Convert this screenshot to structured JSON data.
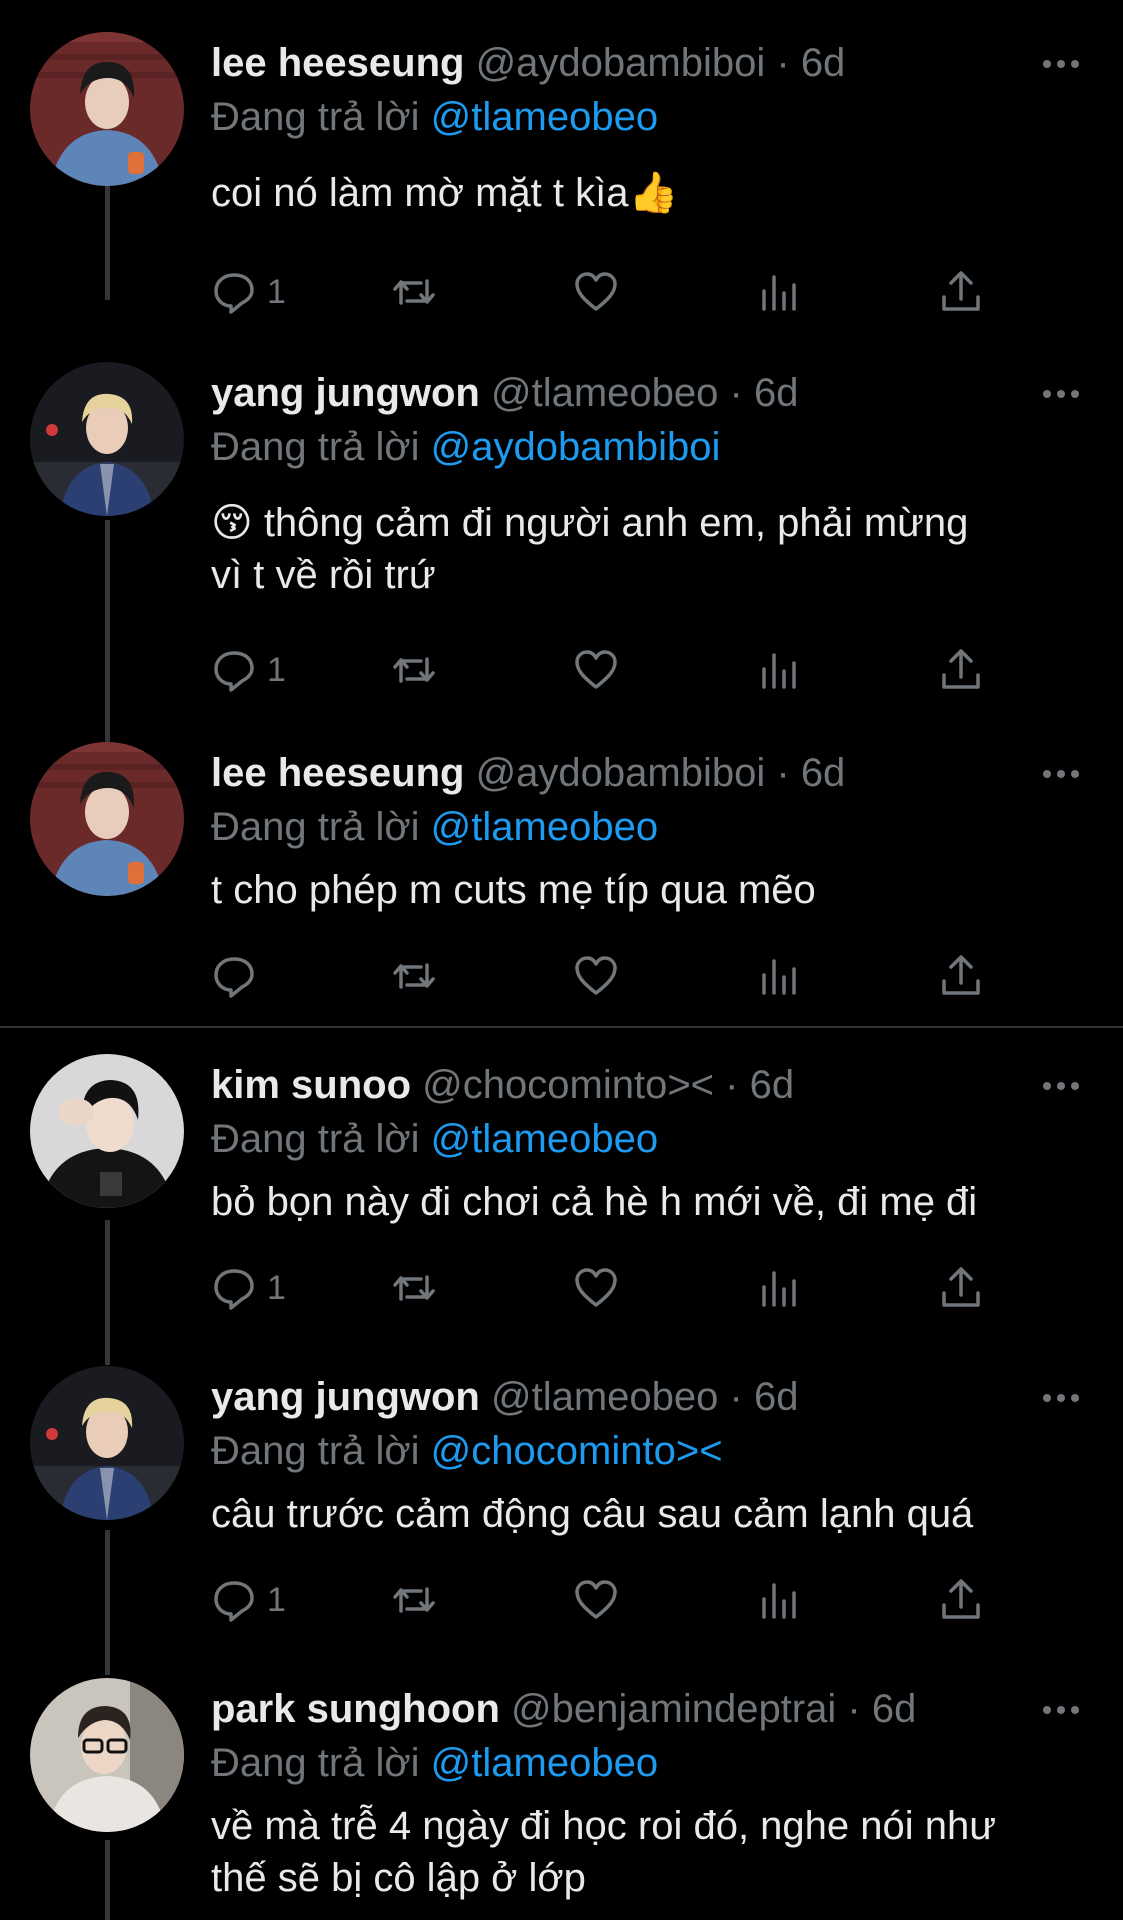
{
  "tweets": [
    {
      "name": "lee heeseung",
      "handle": "@aydobambiboi",
      "time": "6d",
      "reply_label": "Đang trả lời",
      "reply_to": "@tlameobeo",
      "text": "coi nó làm mờ mặt t kìa👍",
      "text_extra": "",
      "reply_count": "1",
      "avatar_icon": "person-avatar-denim-jacket"
    },
    {
      "name": "yang jungwon",
      "handle": "@tlameobeo",
      "time": "6d",
      "reply_label": "Đang trả lời",
      "reply_to": "@aydobambiboi",
      "text": "😚  thông cảm đi người anh em, phải mừng",
      "text_extra": "vì t về rồi trứ",
      "reply_count": "1",
      "avatar_icon": "person-avatar-blonde-track-jacket"
    },
    {
      "name": "lee heeseung",
      "handle": "@aydobambiboi",
      "time": "6d",
      "reply_label": "Đang trả lời",
      "reply_to": "@tlameobeo",
      "text": "t cho phép m cuts mẹ típ qua mẽo",
      "text_extra": "",
      "reply_count": "",
      "avatar_icon": "person-avatar-denim-jacket"
    },
    {
      "name": "kim sunoo",
      "handle": "@chocominto><",
      "time": "6d",
      "reply_label": "Đang trả lời",
      "reply_to": "@tlameobeo",
      "text": "bỏ bọn này đi chơi cả hè h mới về, đi mẹ đi",
      "text_extra": "",
      "reply_count": "1",
      "avatar_icon": "person-avatar-black-hoodie"
    },
    {
      "name": "yang jungwon",
      "handle": "@tlameobeo",
      "time": "6d",
      "reply_label": "Đang trả lời",
      "reply_to": "@chocominto><",
      "text": "câu trước cảm động câu sau cảm lạnh quá",
      "text_extra": "",
      "reply_count": "1",
      "avatar_icon": "person-avatar-blonde-track-jacket"
    },
    {
      "name": "park sunghoon",
      "handle": "@benjamindeptrai",
      "time": "6d",
      "reply_label": "Đang trả lời",
      "reply_to": "@tlameobeo",
      "text": "về mà trễ 4 ngày đi học roi đó, nghe nói như",
      "text_extra": "thế sẽ bị cô lập ở lớp",
      "reply_count": "",
      "avatar_icon": "person-avatar-glasses"
    }
  ],
  "separator": "·",
  "colors": {
    "background": "#000000",
    "text": "#e7e9ea",
    "muted": "#71767b",
    "mention": "#1d9bf0",
    "thread_line": "#333639"
  }
}
